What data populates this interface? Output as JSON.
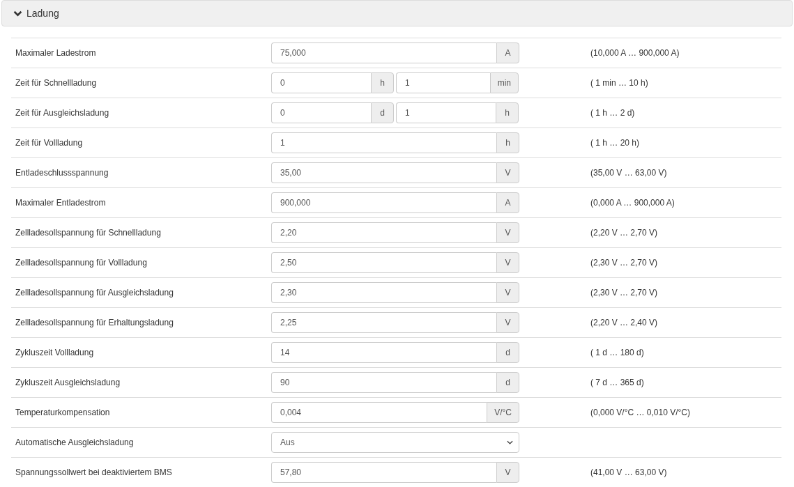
{
  "panel": {
    "title": "Ladung",
    "expanded": true
  },
  "rows": [
    {
      "kind": "single",
      "label": "Maximaler Ladestrom",
      "fields": [
        {
          "value": "75,000",
          "unit": "A"
        }
      ],
      "range": "(10,000 A … 900,000 A)"
    },
    {
      "kind": "double",
      "label": "Zeit für Schnellladung",
      "fields": [
        {
          "value": "0",
          "unit": "h"
        },
        {
          "value": "1",
          "unit": "min"
        }
      ],
      "range": "( 1 min … 10 h)"
    },
    {
      "kind": "double",
      "label": "Zeit für Ausgleichsladung",
      "fields": [
        {
          "value": "0",
          "unit": "d"
        },
        {
          "value": "1",
          "unit": "h"
        }
      ],
      "range": "( 1 h … 2 d)"
    },
    {
      "kind": "single",
      "label": "Zeit für Vollladung",
      "fields": [
        {
          "value": "1",
          "unit": "h"
        }
      ],
      "range": "( 1 h … 20 h)"
    },
    {
      "kind": "single",
      "label": "Entladeschlussspannung",
      "fields": [
        {
          "value": "35,00",
          "unit": "V"
        }
      ],
      "range": "(35,00 V … 63,00 V)"
    },
    {
      "kind": "single",
      "label": "Maximaler Entladestrom",
      "fields": [
        {
          "value": "900,000",
          "unit": "A"
        }
      ],
      "range": "(0,000 A … 900,000 A)"
    },
    {
      "kind": "single",
      "label": "Zellladesollspannung für Schnellladung",
      "fields": [
        {
          "value": "2,20",
          "unit": "V"
        }
      ],
      "range": "(2,20 V … 2,70 V)"
    },
    {
      "kind": "single",
      "label": "Zellladesollspannung für Vollladung",
      "fields": [
        {
          "value": "2,50",
          "unit": "V"
        }
      ],
      "range": "(2,30 V … 2,70 V)"
    },
    {
      "kind": "single",
      "label": "Zellladesollspannung für Ausgleichsladung",
      "fields": [
        {
          "value": "2,30",
          "unit": "V"
        }
      ],
      "range": "(2,30 V … 2,70 V)"
    },
    {
      "kind": "single",
      "label": "Zellladesollspannung für Erhaltungsladung",
      "fields": [
        {
          "value": "2,25",
          "unit": "V"
        }
      ],
      "range": "(2,20 V … 2,40 V)"
    },
    {
      "kind": "single",
      "label": "Zykluszeit Vollladung",
      "fields": [
        {
          "value": "14",
          "unit": "d"
        }
      ],
      "range": "( 1 d … 180 d)"
    },
    {
      "kind": "single",
      "label": "Zykluszeit Ausgleichsladung",
      "fields": [
        {
          "value": "90",
          "unit": "d"
        }
      ],
      "range": "( 7 d … 365 d)"
    },
    {
      "kind": "single",
      "label": "Temperaturkompensation",
      "fields": [
        {
          "value": "0,004",
          "unit": "V/°C"
        }
      ],
      "range": "(0,000 V/°C … 0,010 V/°C)"
    },
    {
      "kind": "select",
      "label": "Automatische Ausgleichsladung",
      "fields": [
        {
          "value": "Aus"
        }
      ]
    },
    {
      "kind": "single",
      "label": "Spannungssollwert bei deaktiviertem BMS",
      "fields": [
        {
          "value": "57,80",
          "unit": "V"
        }
      ],
      "range": "(41,00 V … 63,00 V)"
    }
  ]
}
